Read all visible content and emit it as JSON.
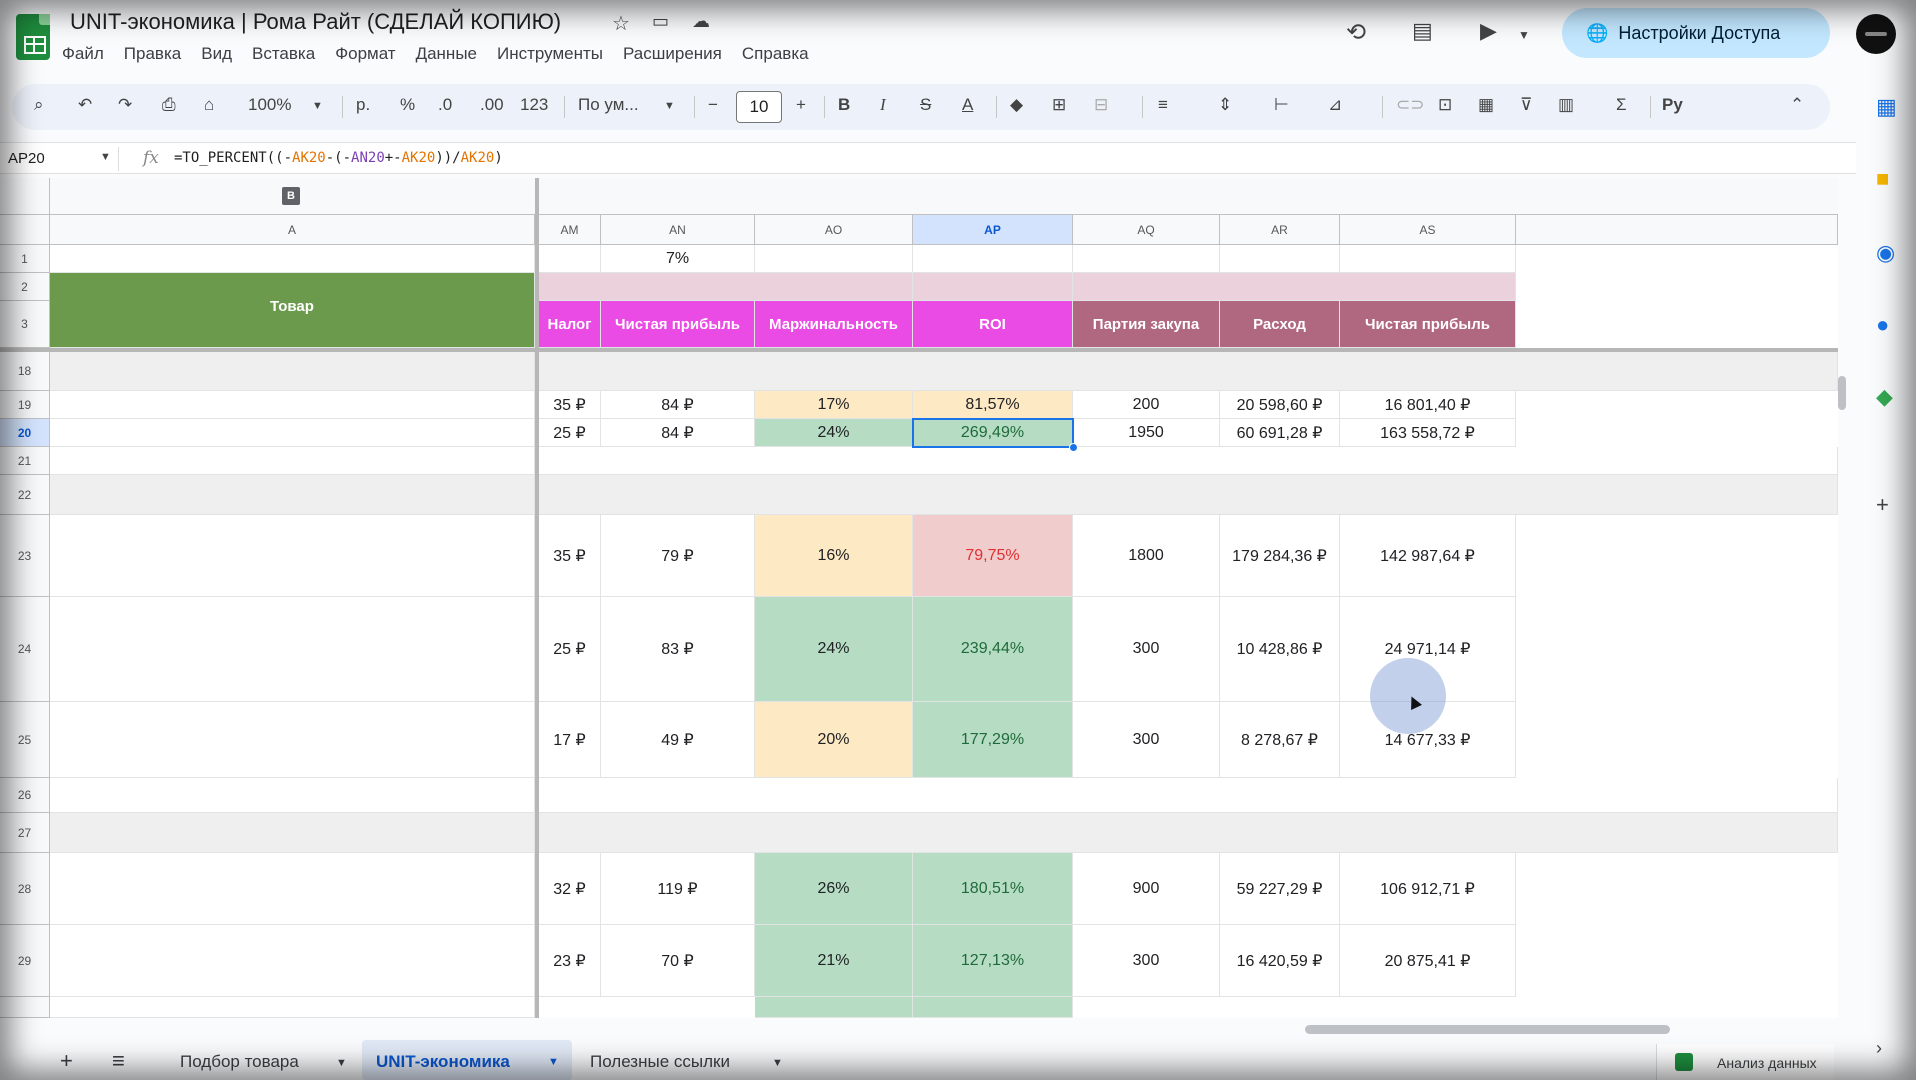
{
  "doc": {
    "title": "UNIT-экономика | Рома Райт (СДЕЛАЙ КОПИЮ)"
  },
  "menu": [
    "Файл",
    "Правка",
    "Вид",
    "Вставка",
    "Формат",
    "Данные",
    "Инструменты",
    "Расширения",
    "Справка"
  ],
  "share_label": "Настройки Доступа",
  "toolbar": {
    "zoom": "100%",
    "currency": "р.",
    "percent": "%",
    "dec_dec": ".0",
    "dec_inc": ".00",
    "num_format": "123",
    "font": "По ум...",
    "font_size": "10",
    "bold": "B",
    "italic": "I",
    "strike": "S",
    "text_color": "A",
    "sum": "Σ",
    "input_tools": "Py"
  },
  "formula": {
    "cell_ref": "AP20",
    "fx": "fx",
    "p1": "=TO_PERCENT((-",
    "r1": "AK20",
    "p2": "-(-",
    "r2": "AN20",
    "p3": "+-",
    "r3": "AK20",
    "p4": "))/",
    "r4": "AK20",
    "p5": ")"
  },
  "group_level": "B",
  "columns": {
    "A": "A",
    "AM": "AM",
    "AN": "AN",
    "AO": "AO",
    "AP": "AP",
    "AQ": "AQ",
    "AR": "AR",
    "AS": "AS"
  },
  "header_cells": {
    "an1": "7%",
    "tovar": "Товар",
    "nalog": "Налог",
    "pribyl": "Чистая прибыль",
    "marzha": "Маржинальность",
    "roi": "ROI",
    "partiya": "Партия закупа",
    "rashod": "Расход",
    "pribyl2": "Чистая прибыль"
  },
  "rows": [
    {
      "num": "1"
    },
    {
      "num": "2"
    },
    {
      "num": "3"
    },
    {
      "num": "18"
    },
    {
      "num": "19",
      "am": "35 ₽",
      "an": "84 ₽",
      "ao": "17%",
      "ap": "81,57%",
      "aq": "200",
      "ar": "20 598,60 ₽",
      "as": "16 801,40 ₽"
    },
    {
      "num": "20",
      "am": "25 ₽",
      "an": "84 ₽",
      "ao": "24%",
      "ap": "269,49%",
      "aq": "1950",
      "ar": "60 691,28 ₽",
      "as": "163 558,72 ₽"
    },
    {
      "num": "21"
    },
    {
      "num": "22"
    },
    {
      "num": "23",
      "am": "35 ₽",
      "an": "79 ₽",
      "ao": "16%",
      "ap": "79,75%",
      "aq": "1800",
      "ar": "179 284,36 ₽",
      "as": "142 987,64 ₽"
    },
    {
      "num": "24",
      "am": "25 ₽",
      "an": "83 ₽",
      "ao": "24%",
      "ap": "239,44%",
      "aq": "300",
      "ar": "10 428,86 ₽",
      "as": "24 971,14 ₽"
    },
    {
      "num": "25",
      "am": "17 ₽",
      "an": "49 ₽",
      "ao": "20%",
      "ap": "177,29%",
      "aq": "300",
      "ar": "8 278,67 ₽",
      "as": "14 677,33 ₽"
    },
    {
      "num": "26"
    },
    {
      "num": "27"
    },
    {
      "num": "28",
      "am": "32 ₽",
      "an": "119 ₽",
      "ao": "26%",
      "ap": "180,51%",
      "aq": "900",
      "ar": "59 227,29 ₽",
      "as": "106 912,71 ₽"
    },
    {
      "num": "29",
      "am": "23 ₽",
      "an": "70 ₽",
      "ao": "21%",
      "ap": "127,13%",
      "aq": "300",
      "ar": "16 420,59 ₽",
      "as": "20 875,41 ₽"
    }
  ],
  "tabs": {
    "add": "+",
    "list": "≡",
    "t1": "Подбор товара",
    "t2": "UNIT-экономика",
    "t3": "Полезные ссылки",
    "explore": "Анализ данных"
  }
}
